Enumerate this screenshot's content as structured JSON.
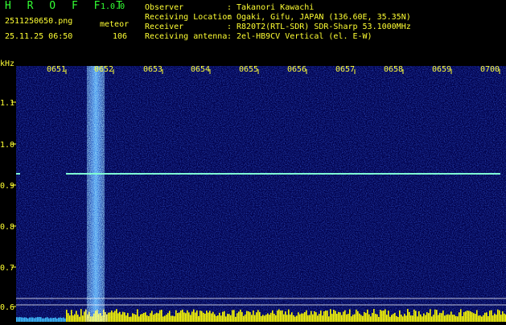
{
  "header": {
    "app_title": "H R O F F T",
    "version": "1.0.0",
    "file_name": "2511250650.png",
    "mode": "meteor",
    "datetime": "25.11.25 06:50",
    "count": "106"
  },
  "info": [
    {
      "label": "Observer",
      "value": "Takanori Kawachi"
    },
    {
      "label": "Receiving Location",
      "value": "Ogaki, Gifu, JAPAN (136.60E, 35.35N)"
    },
    {
      "label": "Receiver",
      "value": "R820T2(RTL-SDR) SDR-Sharp 53.1000MHz"
    },
    {
      "label": "Receiving antenna",
      "value": "2el-HB9CV Vertical (el. E-W)"
    }
  ],
  "spectrogram": {
    "y_unit": "kHz",
    "time_ticks": [
      "0651",
      "0652",
      "0653",
      "0654",
      "0655",
      "0656",
      "0657",
      "0658",
      "0659",
      "0700"
    ],
    "freq_ticks": [
      "1.1",
      "1.0",
      "0.9",
      "0.8",
      "0.7",
      "0.6"
    ],
    "colors": {
      "background": "#00004a",
      "grid": "#ffffff",
      "tone": "#7fffd4",
      "meteor": "#40b0ff",
      "bottom_noise": "#ffff00"
    }
  }
}
